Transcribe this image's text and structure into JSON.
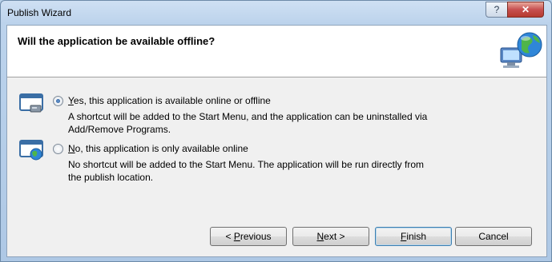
{
  "window": {
    "title": "Publish Wizard",
    "help_label": "?",
    "close_label": "✕"
  },
  "header": {
    "question": "Will the application be available offline?"
  },
  "options": [
    {
      "mnemonic": "Y",
      "label_rest": "es, this application is available online or offline",
      "description_line1": "A shortcut will be added to the Start Menu, and the application can be uninstalled via",
      "description_line2": "Add/Remove Programs.",
      "selected": true
    },
    {
      "mnemonic": "N",
      "label_rest": "o, this application is only available online",
      "description_line1": "No shortcut will be added to the Start Menu. The application will be run directly from",
      "description_line2": "the publish location.",
      "selected": false
    }
  ],
  "buttons": {
    "previous_prefix": "< ",
    "previous_mnemonic": "P",
    "previous_rest": "revious",
    "next_mnemonic": "N",
    "next_rest": "ext >",
    "finish_mnemonic": "F",
    "finish_rest": "inish",
    "cancel_label": "Cancel"
  }
}
